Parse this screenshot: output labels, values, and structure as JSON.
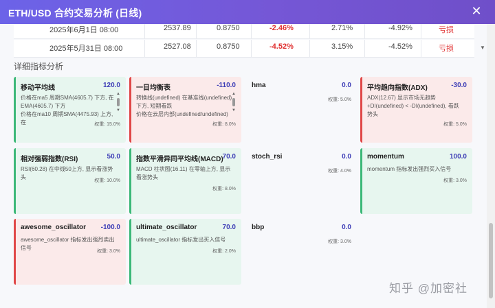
{
  "window": {
    "title": "ETH/USD 合约交易分析 (日线)",
    "close_glyph": "✕"
  },
  "table": {
    "rows": [
      {
        "date": "2025年6月1日 08:00",
        "price": "2537.89",
        "signal": "0.8750",
        "change": "-2.46%",
        "v1": "2.71%",
        "v2": "-4.92%",
        "tag": "亏损"
      },
      {
        "date": "2025年5月31日 08:00",
        "price": "2527.08",
        "signal": "0.8750",
        "change": "-4.52%",
        "v1": "3.15%",
        "v2": "-4.52%",
        "tag": "亏损"
      }
    ]
  },
  "section_title": "详细指标分析",
  "cards": [
    {
      "name": "移动平均线",
      "score": "120.0",
      "lines": [
        "价格在ma5 周期SMA(4605.7) 下方, 在EMA(4605.7) 下方",
        "价格在ma10 周期SMA(4475.93) 上方, 在"
      ],
      "weight": "权重: 15.0%",
      "tone": "pos"
    },
    {
      "name": "一目均衡表",
      "score": "-110.0",
      "lines": [
        "转换线(undefined) 在基准线(undefined) 下方, 短期看跌",
        "价格在云层内部(undefined/undefined)"
      ],
      "weight": "权重: 8.0%",
      "tone": "neg"
    },
    {
      "name": "hma",
      "score": "0.0",
      "lines": [],
      "weight": "权重: 5.0%",
      "tone": "neu"
    },
    {
      "name": "平均趋向指数(ADX)",
      "score": "-30.0",
      "lines": [
        "ADX(12.67) 显示市场无趋势",
        "+DI(undefined) < -DI(undefined), 看跌势头"
      ],
      "weight": "权重: 5.0%",
      "tone": "neg"
    },
    {
      "name": "相对强弱指数(RSI)",
      "score": "50.0",
      "lines": [
        "RSI(60.28) 在中线50上方, 显示看涨势头"
      ],
      "weight": "权重: 10.0%",
      "tone": "pos"
    },
    {
      "name": "指数平滑异同平均线(MACD)",
      "score": "70.0",
      "lines": [
        "MACD 柱状图(16.11) 在零轴上方, 显示看涨势头"
      ],
      "weight": "权重: 8.0%",
      "tone": "pos"
    },
    {
      "name": "stoch_rsi",
      "score": "0.0",
      "lines": [],
      "weight": "权重: 4.0%",
      "tone": "neu"
    },
    {
      "name": "momentum",
      "score": "100.0",
      "lines": [
        "momentum 指标发出强烈买入信号"
      ],
      "weight": "权重: 3.0%",
      "tone": "pos"
    },
    {
      "name": "awesome_oscillator",
      "score": "-100.0",
      "lines": [
        "awesome_oscillator 指标发出强烈卖出信号"
      ],
      "weight": "权重: 3.0%",
      "tone": "neg"
    },
    {
      "name": "ultimate_oscillator",
      "score": "70.0",
      "lines": [
        "ultimate_oscillator 指标发出买入信号"
      ],
      "weight": "权重: 2.0%",
      "tone": "pos"
    },
    {
      "name": "bbp",
      "score": "0.0",
      "lines": [],
      "weight": "权重: 3.0%",
      "tone": "neu"
    }
  ],
  "watermark": "知乎 @加密社",
  "colors": {
    "title_gradient_start": "#6c63e8",
    "title_gradient_end": "#6f4fc9",
    "positive": "#3cb878",
    "negative": "#e04848",
    "score": "#3d3db6",
    "loss": "#e03131"
  }
}
